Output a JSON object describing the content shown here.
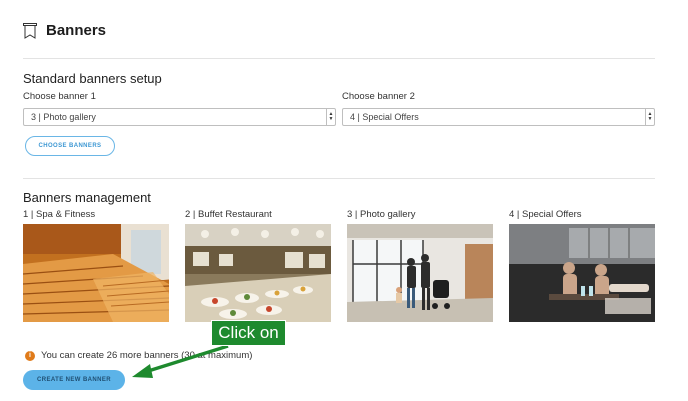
{
  "header": {
    "title": "Banners"
  },
  "standard_setup": {
    "title": "Standard banners setup",
    "banner1_label": "Choose banner 1",
    "banner1_value": "3 | Photo gallery",
    "banner2_label": "Choose banner 2",
    "banner2_value": "4 | Special Offers",
    "choose_button": "CHOOSE BANNERS"
  },
  "management": {
    "title": "Banners management",
    "banners": [
      {
        "label": "1 | Spa & Fitness"
      },
      {
        "label": "2 | Buffet Restaurant"
      },
      {
        "label": "3 | Photo gallery"
      },
      {
        "label": "4 | Special Offers"
      }
    ],
    "info_text": "You can create 26 more banners (30 at maximum)",
    "create_button": "CREATE NEW BANNER"
  },
  "annotation": {
    "callout_text": "Click on",
    "color": "#1e8a2e"
  },
  "colors": {
    "accent": "#5cb3e8",
    "info": "#e07b1a"
  }
}
